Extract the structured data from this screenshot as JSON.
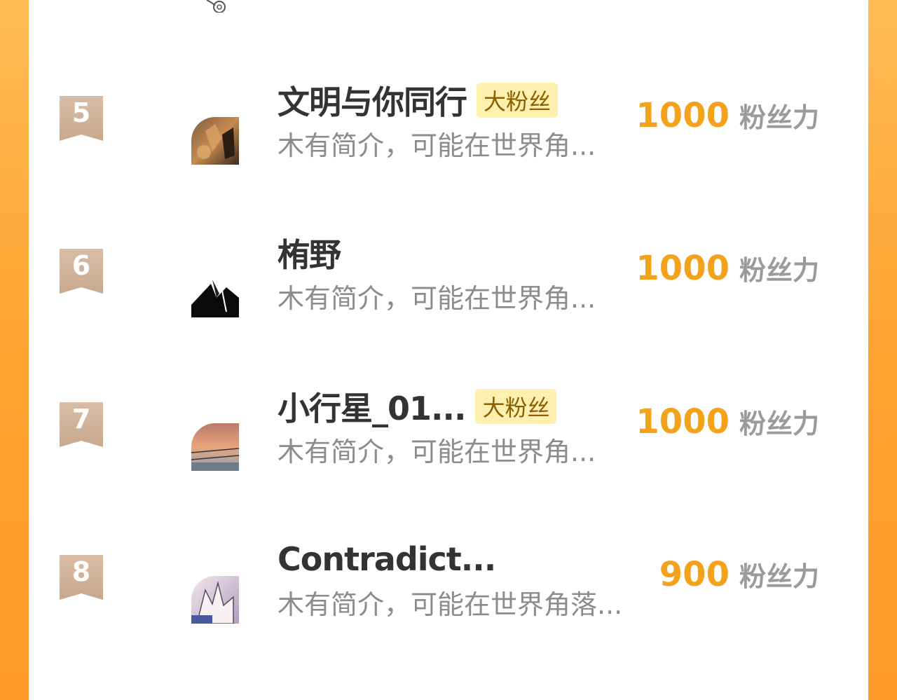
{
  "colors": {
    "accent": "#f2a31b",
    "badge_bg": "#fff0b0",
    "rank_badge": "#c8a98f",
    "border_orange": "#ffa331"
  },
  "rows": [
    {
      "rank": "5",
      "name": "文明与你同行",
      "badge": "大粉丝",
      "intro": "木有简介，可能在世界角...",
      "score": "1000",
      "unit": "粉丝力"
    },
    {
      "rank": "6",
      "name": "栯野",
      "badge": "",
      "intro": "木有简介，可能在世界角...",
      "score": "1000",
      "unit": "粉丝力"
    },
    {
      "rank": "7",
      "name": "小行星_01...",
      "badge": "大粉丝",
      "intro": "木有简介，可能在世界角...",
      "score": "1000",
      "unit": "粉丝力"
    },
    {
      "rank": "8",
      "name": "Contradict...",
      "badge": "",
      "intro": "木有简介，可能在世界角落...",
      "score": "900",
      "unit": "粉丝力"
    }
  ]
}
